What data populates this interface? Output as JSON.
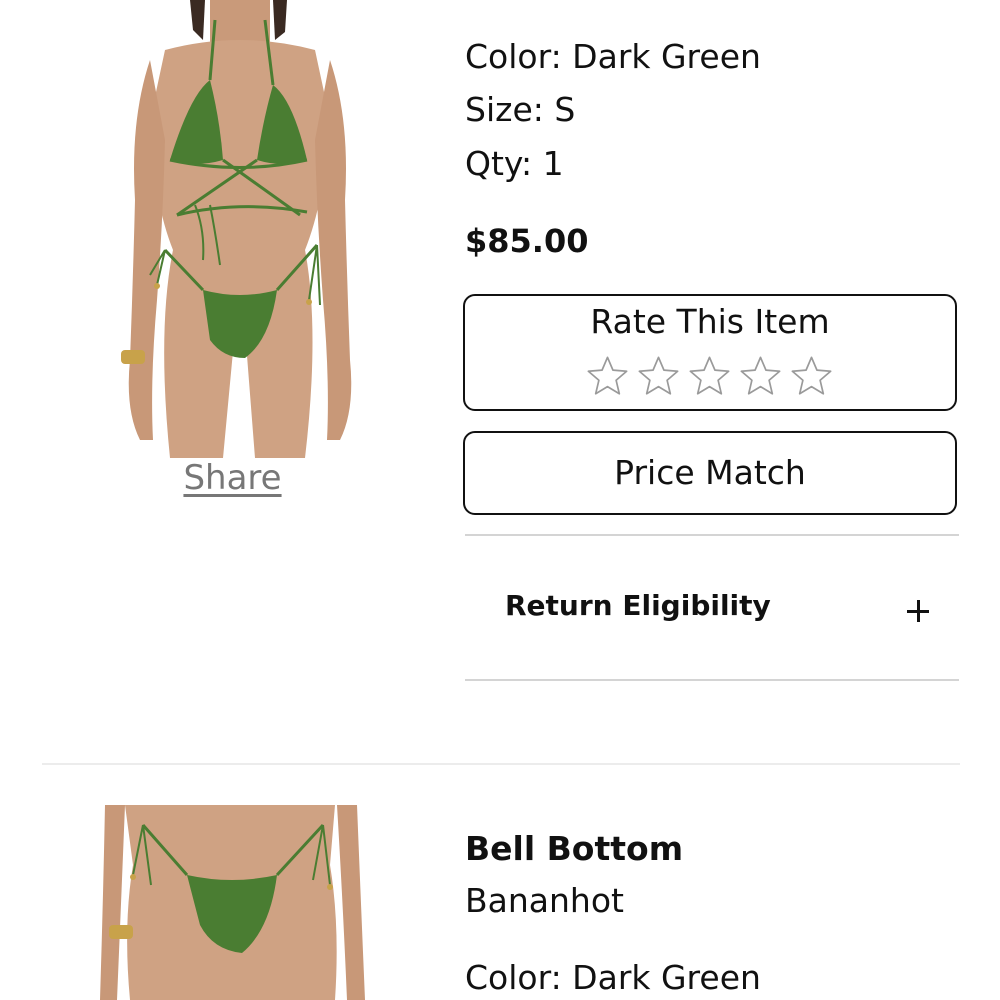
{
  "item1": {
    "color": "Color: Dark Green",
    "size": "Size: S",
    "qty": "Qty: 1",
    "price": "$85.00",
    "share_label": "Share",
    "rate_title": "Rate This Item",
    "rating_stars": 5,
    "rating_value": 0,
    "price_match_label": "Price Match",
    "return_label": "Return Eligibility",
    "product_color_hex": "#4a7d32"
  },
  "item2": {
    "name": "Bell Bottom",
    "brand": "Bananhot",
    "color": "Color: Dark Green"
  }
}
